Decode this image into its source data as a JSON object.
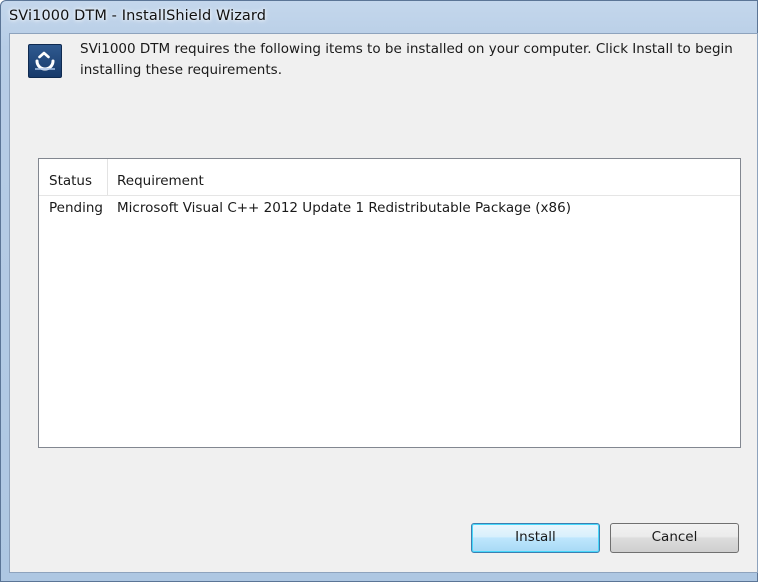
{
  "window": {
    "title": "SVi1000 DTM - InstallShield Wizard"
  },
  "header": {
    "icon": "installshield-wizard-icon",
    "message": "SVi1000 DTM requires the following items to be installed on your computer. Click Install to begin installing these requirements."
  },
  "requirements_list": {
    "columns": [
      "Status",
      "Requirement"
    ],
    "rows": [
      {
        "status": "Pending",
        "requirement": "Microsoft Visual C++ 2012 Update 1 Redistributable Package (x86)"
      }
    ]
  },
  "buttons": {
    "install_label": "Install",
    "cancel_label": "Cancel"
  },
  "colors": {
    "title_bar": "#b7cde6",
    "dialog_background": "#f0f0f0",
    "default_button_border": "#3c7fb1"
  }
}
